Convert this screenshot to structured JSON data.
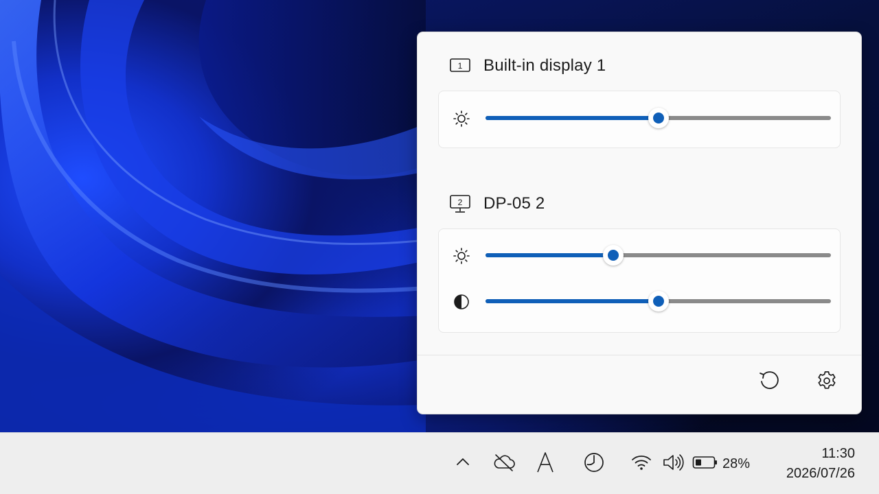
{
  "flyout": {
    "monitors": [
      {
        "number": "1",
        "name": "Built-in display 1",
        "icon": "laptop-display-icon",
        "sliders": [
          {
            "kind": "brightness",
            "icon": "brightness-icon",
            "value": 0.5
          }
        ]
      },
      {
        "number": "2",
        "name": "DP-05 2",
        "icon": "external-monitor-icon",
        "sliders": [
          {
            "kind": "brightness",
            "icon": "brightness-icon",
            "value": 0.37
          },
          {
            "kind": "contrast",
            "icon": "contrast-icon",
            "value": 0.5
          }
        ]
      }
    ],
    "footer": {
      "reset_icon": "reset-icon",
      "settings_icon": "gear-icon"
    },
    "accent_color": "#0f5fb8"
  },
  "taskbar": {
    "tray_icons": [
      "chevron-up-icon",
      "cloud-off-icon",
      "font-icon",
      "clock-app-icon",
      "wifi-icon",
      "volume-icon",
      "battery-icon"
    ],
    "battery_percent": "28%",
    "time": "11:30",
    "date": "2026/07/26"
  }
}
